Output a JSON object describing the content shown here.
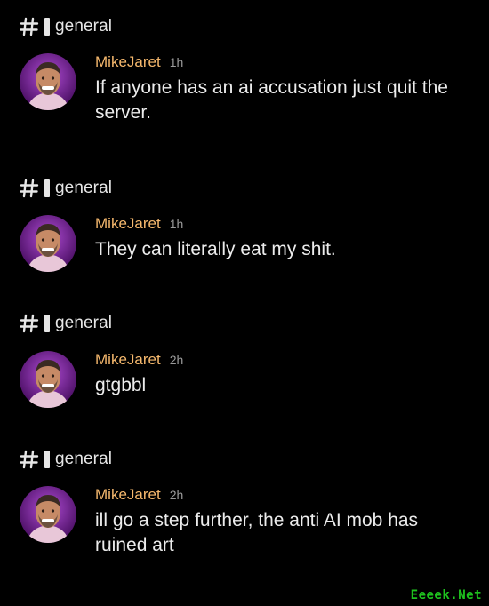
{
  "posts": [
    {
      "channel": "general",
      "username": "MikeJaret",
      "time": "1h",
      "text": "If anyone has an ai accusation just quit the server."
    },
    {
      "channel": "general",
      "username": "MikeJaret",
      "time": "1h",
      "text": "They can literally eat my shit."
    },
    {
      "channel": "general",
      "username": "MikeJaret",
      "time": "2h",
      "text": "gtgbbl"
    },
    {
      "channel": "general",
      "username": "MikeJaret",
      "time": "2h",
      "text": "ill go a step further, the anti AI mob has ruined art"
    }
  ],
  "watermark": "Eeeek.Net",
  "colors": {
    "background": "#000000",
    "username": "#f5b86d",
    "timestamp": "#9a9a9a",
    "avatar_ring": "#8e2bb5",
    "watermark": "#1ec21e"
  }
}
